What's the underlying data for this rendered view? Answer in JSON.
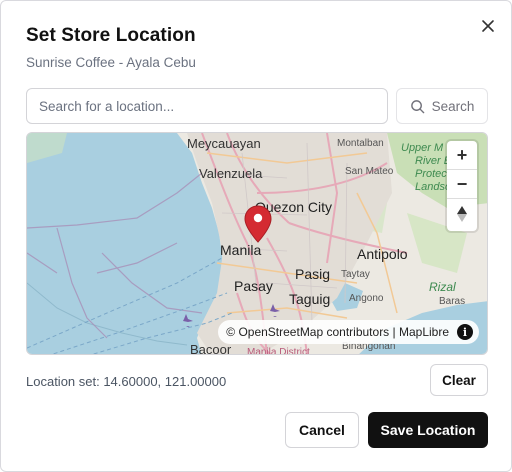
{
  "dialog": {
    "title": "Set Store Location",
    "subtitle": "Sunrise Coffee - Ayala Cebu",
    "close_icon": "close-icon"
  },
  "search": {
    "placeholder": "Search for a location...",
    "value": "",
    "button_label": "Search",
    "button_icon": "search-icon"
  },
  "map": {
    "labels": {
      "meycauayan": "Meycauayan",
      "montalban": "Montalban",
      "valenzuela": "Valenzuela",
      "san_mateo": "San Mateo",
      "quezon_city": "Quezon City",
      "manila": "Manila",
      "antipolo": "Antipolo",
      "pasig": "Pasig",
      "taytay": "Taytay",
      "pasay": "Pasay",
      "taguig": "Taguig",
      "angono": "Angono",
      "rizal": "Rizal",
      "baras": "Baras",
      "bacoor": "Bacoor",
      "binangonan": "Binangonan",
      "manila_district": "Manila District",
      "park_line1": "Upper M",
      "park_line2": "River E",
      "park_line3": "Protect",
      "park_line4": "Landsc"
    },
    "zoom_in": "+",
    "zoom_out": "−",
    "compass": "▲",
    "attribution": "© OpenStreetMap contributors | MapLibre",
    "info": "i",
    "marker_icon": "map-pin-icon",
    "marker_color": "#d42b32"
  },
  "status": {
    "text": "Location set: 14.60000, 121.00000",
    "clear_label": "Clear"
  },
  "footer": {
    "cancel_label": "Cancel",
    "save_label": "Save Location"
  }
}
